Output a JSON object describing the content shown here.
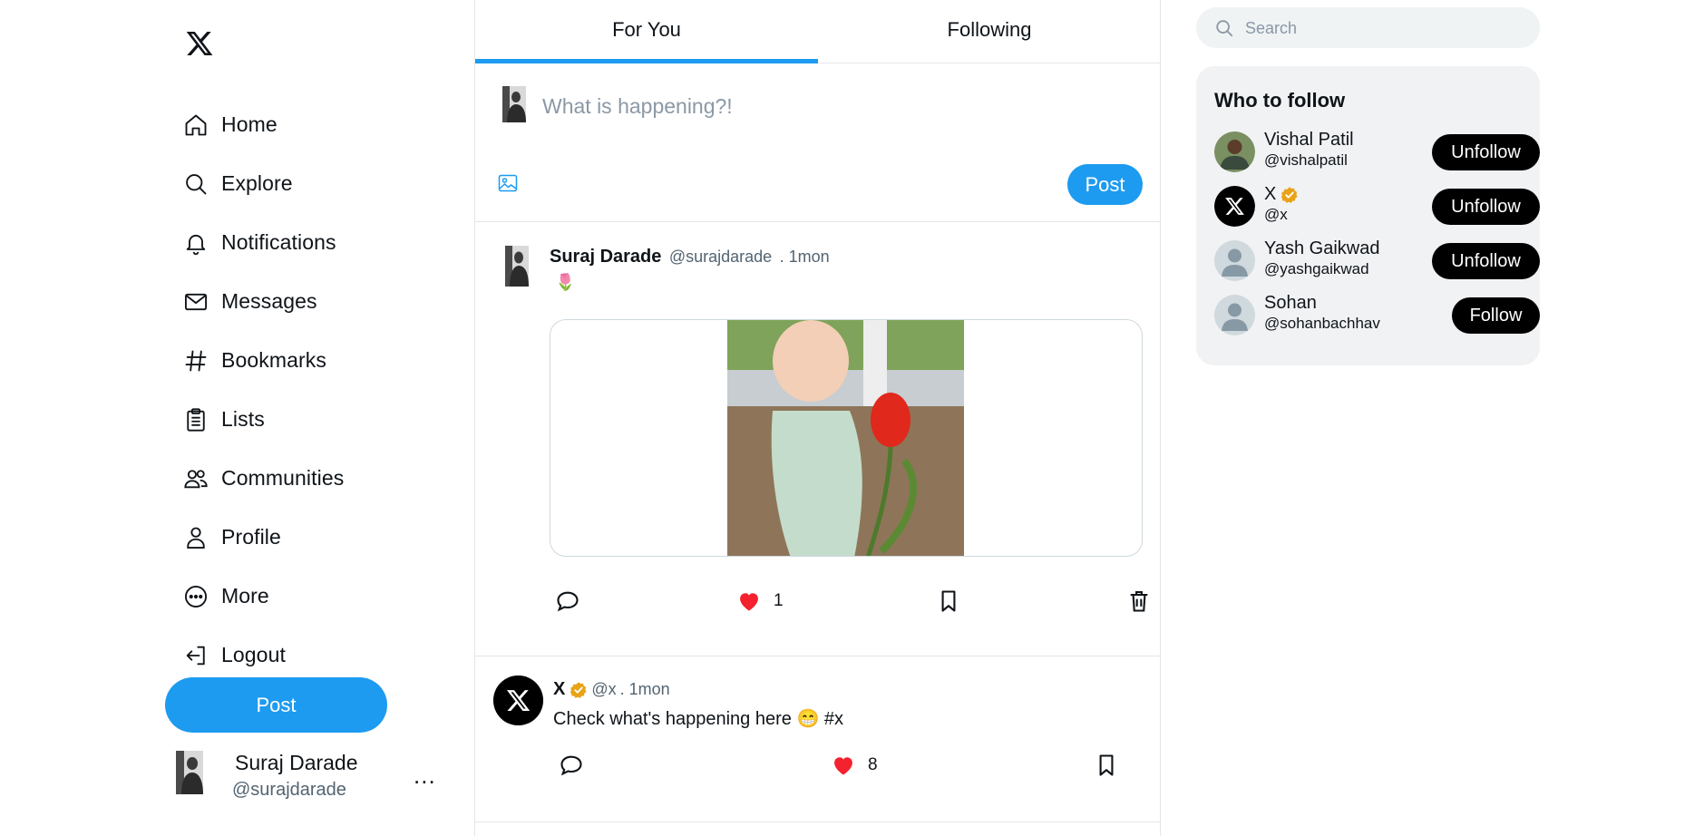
{
  "nav": {
    "items": [
      {
        "label": "Home"
      },
      {
        "label": "Explore"
      },
      {
        "label": "Notifications"
      },
      {
        "label": "Messages"
      },
      {
        "label": "Bookmarks"
      },
      {
        "label": "Lists"
      },
      {
        "label": "Communities"
      },
      {
        "label": "Profile"
      },
      {
        "label": "More"
      },
      {
        "label": "Logout"
      }
    ],
    "post_label": "Post"
  },
  "current_user": {
    "name": "Suraj Darade",
    "handle": "@surajdarade",
    "more": "..."
  },
  "tabs": [
    {
      "label": "For You",
      "active": true
    },
    {
      "label": "Following",
      "active": false
    }
  ],
  "composer": {
    "placeholder": "What is happening?!",
    "post_label": "Post"
  },
  "posts": [
    {
      "name": "Suraj Darade",
      "handle": "@surajdarade",
      "time": ". 1mon",
      "text": "🌷",
      "likes": "1"
    },
    {
      "name": "X",
      "handle": "@x",
      "time": ". 1mon",
      "text": "Check what's happening here 😁 #x",
      "likes": "8"
    }
  ],
  "search": {
    "placeholder": "Search"
  },
  "who_to_follow": {
    "title": "Who to follow",
    "users": [
      {
        "name": "Vishal Patil",
        "handle": "@vishalpatil",
        "button": "Unfollow"
      },
      {
        "name": "X",
        "handle": "@x",
        "button": "Unfollow"
      },
      {
        "name": "Yash Gaikwad",
        "handle": "@yashgaikwad",
        "button": "Unfollow"
      },
      {
        "name": "Sohan",
        "handle": "@sohanbachhav",
        "button": "Follow"
      }
    ]
  },
  "colors": {
    "accent": "#1d9bf0",
    "like": "#f4212e",
    "verified": "#e8a317",
    "follow_button": "#000000"
  }
}
